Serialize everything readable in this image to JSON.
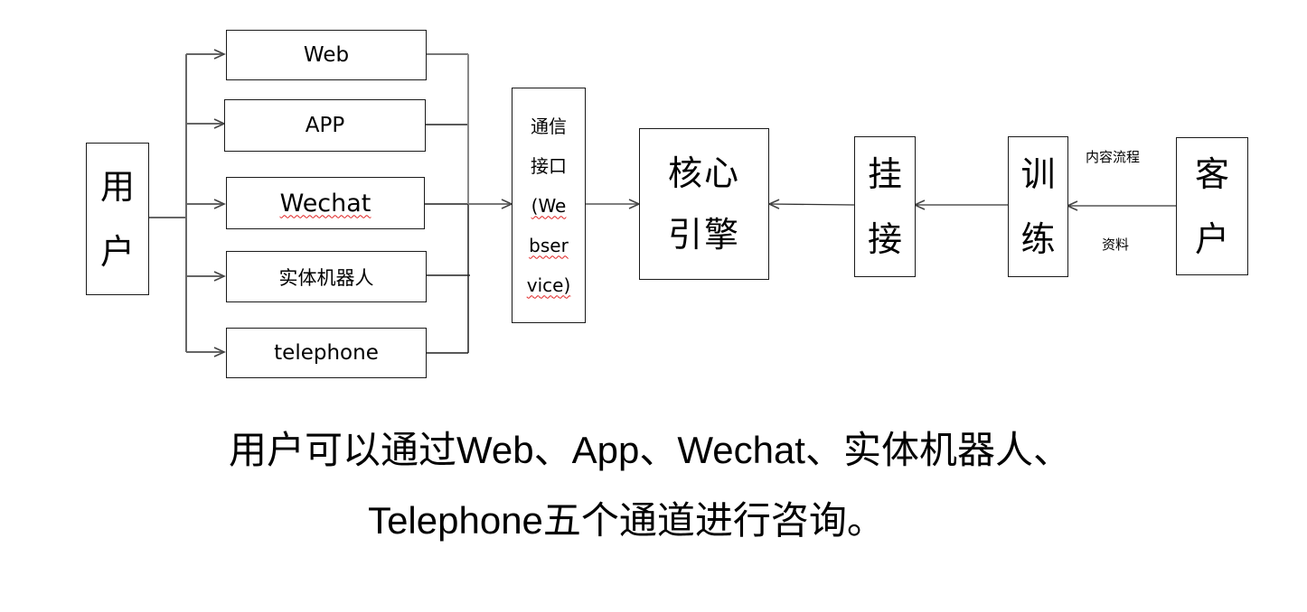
{
  "diagram": {
    "user": {
      "chars": [
        "用",
        "户"
      ]
    },
    "channels": [
      {
        "label": "Web",
        "spellcheck": false
      },
      {
        "label": "APP",
        "spellcheck": false
      },
      {
        "label": "Wechat",
        "spellcheck": true
      },
      {
        "label": "实体机器人",
        "spellcheck": false
      },
      {
        "label": "telephone",
        "spellcheck": false
      }
    ],
    "comm_interface": {
      "lines": [
        "通信",
        "接口",
        "(We",
        "bser",
        "vice)"
      ]
    },
    "core_engine": {
      "lines": [
        "核心",
        "引擎"
      ]
    },
    "mount": {
      "chars": [
        "挂",
        "接"
      ]
    },
    "training": {
      "chars": [
        "训",
        "练"
      ]
    },
    "customer": {
      "chars": [
        "客",
        "户"
      ]
    },
    "customer_edge_labels": {
      "top": "内容流程",
      "bottom": "资料"
    }
  },
  "caption": {
    "line1": "用户可以通过Web、App、Wechat、实体机器人、",
    "line2": "Telephone五个通道进行咨询。"
  },
  "colors": {
    "line": "#555555",
    "box_border": "#1a1a1a",
    "spellcheck": "#e02020"
  }
}
